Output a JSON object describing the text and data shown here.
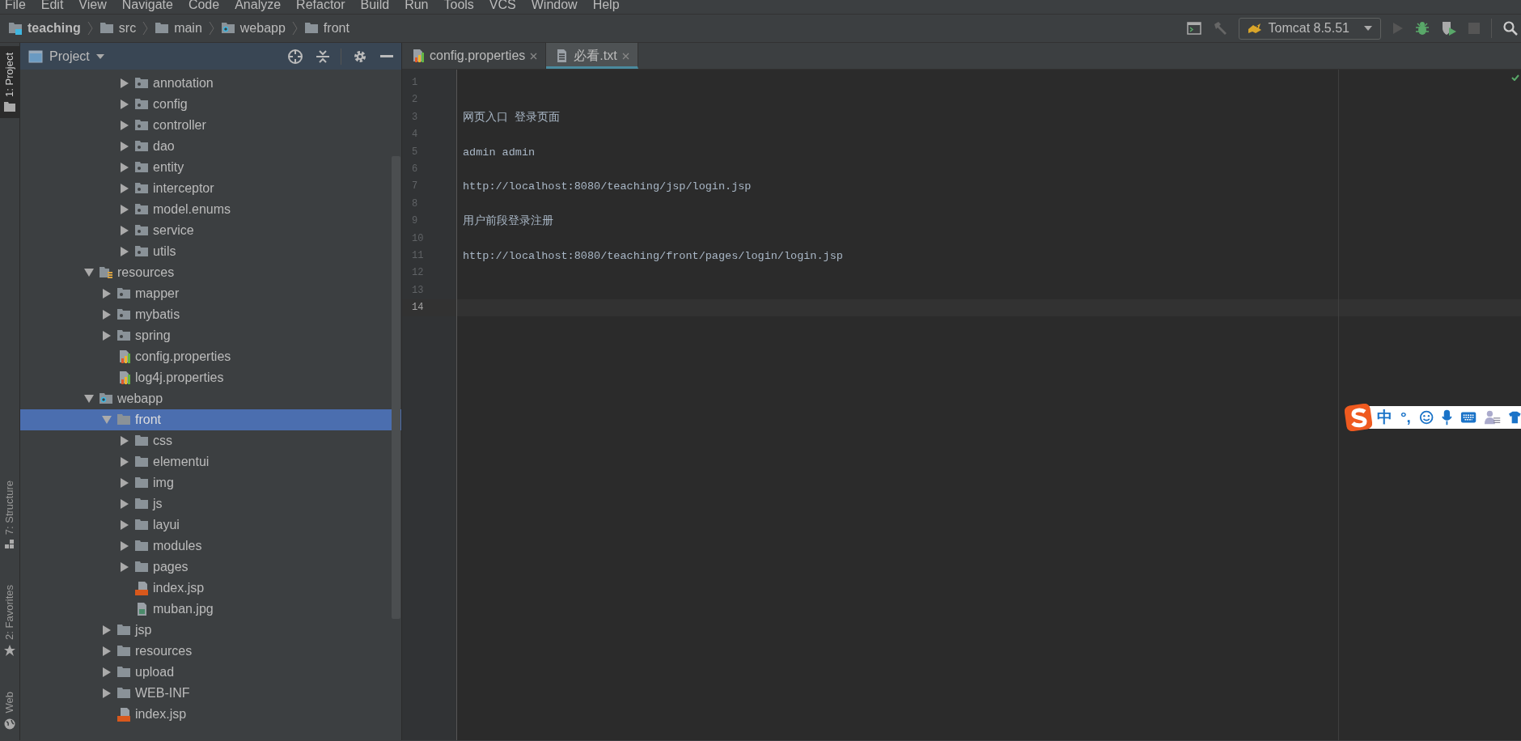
{
  "menu": [
    "File",
    "Edit",
    "View",
    "Navigate",
    "Code",
    "Analyze",
    "Refactor",
    "Build",
    "Run",
    "Tools",
    "VCS",
    "Window",
    "Help"
  ],
  "breadcrumb": [
    {
      "label": "teaching",
      "kind": "module"
    },
    {
      "label": "src",
      "kind": "folder"
    },
    {
      "label": "main",
      "kind": "folder"
    },
    {
      "label": "webapp",
      "kind": "web"
    },
    {
      "label": "front",
      "kind": "folder"
    }
  ],
  "toolbar": {
    "run_config": "Tomcat 8.5.51"
  },
  "side_tabs": [
    {
      "label": "1: Project",
      "selected": true,
      "kind": "folder"
    },
    {
      "label": "7: Structure",
      "selected": false,
      "kind": "structure"
    },
    {
      "label": "2: Favorites",
      "selected": false,
      "kind": "star"
    },
    {
      "label": "Web",
      "selected": false,
      "kind": "globe"
    }
  ],
  "project_panel": {
    "title": "Project",
    "tree_tail": [
      {
        "label": "annotation",
        "kind": "package",
        "expanded": false,
        "selected": false
      },
      {
        "label": "config",
        "kind": "package",
        "expanded": false,
        "selected": false
      },
      {
        "label": "controller",
        "kind": "package",
        "expanded": false,
        "selected": false
      },
      {
        "label": "dao",
        "kind": "package",
        "expanded": false,
        "selected": false
      },
      {
        "label": "entity",
        "kind": "package",
        "expanded": false,
        "selected": false
      },
      {
        "label": "interceptor",
        "kind": "package",
        "expanded": false,
        "selected": false
      },
      {
        "label": "model.enums",
        "kind": "package",
        "expanded": false,
        "selected": false
      },
      {
        "label": "service",
        "kind": "package",
        "expanded": false,
        "selected": false
      },
      {
        "label": "utils",
        "kind": "package",
        "expanded": false,
        "selected": false
      }
    ],
    "tree": [
      {
        "label": "resources",
        "kind": "resources",
        "expanded": true,
        "selected": false,
        "children": [
          {
            "label": "mapper",
            "kind": "package",
            "expanded": false,
            "selected": false
          },
          {
            "label": "mybatis",
            "kind": "package",
            "expanded": false,
            "selected": false
          },
          {
            "label": "spring",
            "kind": "package",
            "expanded": false,
            "selected": false
          },
          {
            "label": "config.properties",
            "kind": "properties",
            "selected": false
          },
          {
            "label": "log4j.properties",
            "kind": "properties",
            "selected": false
          }
        ]
      },
      {
        "label": "webapp",
        "kind": "web",
        "expanded": true,
        "selected": false,
        "children": [
          {
            "label": "front",
            "kind": "folder",
            "expanded": true,
            "selected": true,
            "children": [
              {
                "label": "css",
                "kind": "folder",
                "expanded": false,
                "selected": false
              },
              {
                "label": "elementui",
                "kind": "folder",
                "expanded": false,
                "selected": false
              },
              {
                "label": "img",
                "kind": "folder",
                "expanded": false,
                "selected": false
              },
              {
                "label": "js",
                "kind": "folder",
                "expanded": false,
                "selected": false
              },
              {
                "label": "layui",
                "kind": "folder",
                "expanded": false,
                "selected": false
              },
              {
                "label": "modules",
                "kind": "folder",
                "expanded": false,
                "selected": false
              },
              {
                "label": "pages",
                "kind": "folder",
                "expanded": false,
                "selected": false
              },
              {
                "label": "index.jsp",
                "kind": "jsp",
                "selected": false
              },
              {
                "label": "muban.jpg",
                "kind": "image",
                "selected": false
              }
            ]
          },
          {
            "label": "jsp",
            "kind": "folder",
            "expanded": false,
            "selected": false
          },
          {
            "label": "resources",
            "kind": "folder",
            "expanded": false,
            "selected": false
          },
          {
            "label": "upload",
            "kind": "folder",
            "expanded": false,
            "selected": false
          },
          {
            "label": "WEB-INF",
            "kind": "folder",
            "expanded": false,
            "selected": false
          },
          {
            "label": "index.jsp",
            "kind": "jsp",
            "selected": false
          }
        ]
      }
    ]
  },
  "editor_tabs": [
    {
      "label": "config.properties",
      "kind": "properties",
      "selected": false
    },
    {
      "label": "必看.txt",
      "kind": "text",
      "selected": true
    }
  ],
  "editor_lines": [
    {
      "number": "1",
      "current": false
    },
    {
      "number": "2",
      "current": false
    },
    {
      "number": "3",
      "text": "网页入口 登录页面",
      "current": false
    },
    {
      "number": "4",
      "current": false
    },
    {
      "number": "5",
      "text": "admin admin",
      "current": false
    },
    {
      "number": "6",
      "current": false
    },
    {
      "number": "7",
      "text": "http://localhost:8080/teaching/jsp/login.jsp",
      "current": false
    },
    {
      "number": "8",
      "current": false
    },
    {
      "number": "9",
      "text": "用户前段登录注册",
      "current": false
    },
    {
      "number": "10",
      "current": false
    },
    {
      "number": "11",
      "text": "http://localhost:8080/teaching/front/pages/login/login.jsp",
      "current": false
    },
    {
      "number": "12",
      "current": false
    },
    {
      "number": "13",
      "current": false
    },
    {
      "number": "14",
      "current": true
    }
  ],
  "ime_bar": {
    "mode": "中",
    "punct": "°,"
  }
}
